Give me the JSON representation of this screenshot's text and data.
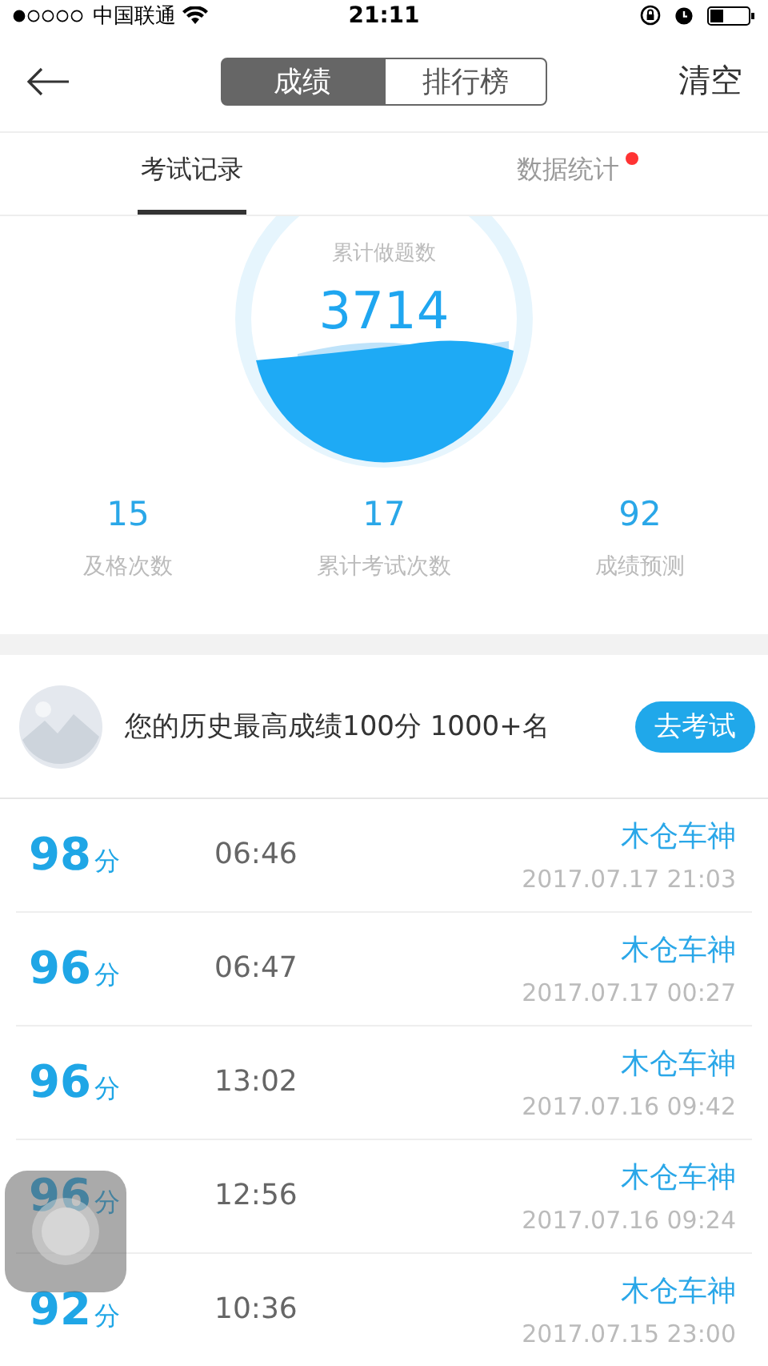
{
  "status_bar": {
    "carrier": "中国联通",
    "time": "21:11"
  },
  "nav": {
    "segments": [
      {
        "label": "成绩",
        "selected": true
      },
      {
        "label": "排行榜",
        "selected": false
      }
    ],
    "action": "清空"
  },
  "tabs": [
    {
      "label": "考试记录",
      "selected": true,
      "badge": false
    },
    {
      "label": "数据统计",
      "selected": false,
      "badge": true
    }
  ],
  "summary": {
    "caption": "累计做题数",
    "total": "3714",
    "stats": [
      {
        "value": "15",
        "label": "及格次数"
      },
      {
        "value": "17",
        "label": "累计考试次数"
      },
      {
        "value": "92",
        "label": "成绩预测"
      }
    ]
  },
  "banner": {
    "text": "您的历史最高成绩100分 1000+名",
    "button": "去考试"
  },
  "records": [
    {
      "score": "98",
      "unit": "分",
      "duration": "06:46",
      "mode": "木仓车神",
      "date": "2017.07.17 21:03"
    },
    {
      "score": "96",
      "unit": "分",
      "duration": "06:47",
      "mode": "木仓车神",
      "date": "2017.07.17 00:27"
    },
    {
      "score": "96",
      "unit": "分",
      "duration": "13:02",
      "mode": "木仓车神",
      "date": "2017.07.16 09:42"
    },
    {
      "score": "96",
      "unit": "分",
      "duration": "12:56",
      "mode": "木仓车神",
      "date": "2017.07.16 09:24"
    },
    {
      "score": "92",
      "unit": "分",
      "duration": "10:36",
      "mode": "木仓车神",
      "date": "2017.07.15 23:00"
    }
  ]
}
